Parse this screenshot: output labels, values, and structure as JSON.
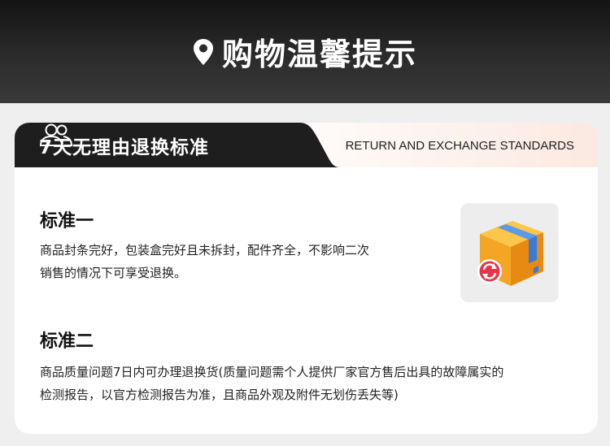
{
  "header": {
    "title": "购物温馨提示",
    "icon": "location-pin-icon"
  },
  "tab": {
    "label": "7天无理由退换标准",
    "icon": "users-icon",
    "english": "RETURN AND EXCHANGE STANDARDS"
  },
  "sections": [
    {
      "title": "标准一",
      "lines": [
        "商品封条完好，包装盒完好且未拆封，配件齐全，不影响二次",
        "销售的情况下可享受退换。"
      ],
      "icon": "return-box-icon"
    },
    {
      "title": "标准二",
      "lines": [
        "商品质量问题7日内可办理退换货(质量问题需个人提供厂家官方售后出具的故障属实的",
        "检测报告，以官方检测报告为准，且商品外观及附件无划伤丢失等)"
      ]
    }
  ],
  "colors": {
    "header_dark": "#1a1a1a",
    "tab_dark": "#1e1e1e",
    "tab_light": "#fbe9e0",
    "box_orange": "#f5a524",
    "box_blue": "#3a7bd5",
    "return_red": "#e8344a"
  }
}
